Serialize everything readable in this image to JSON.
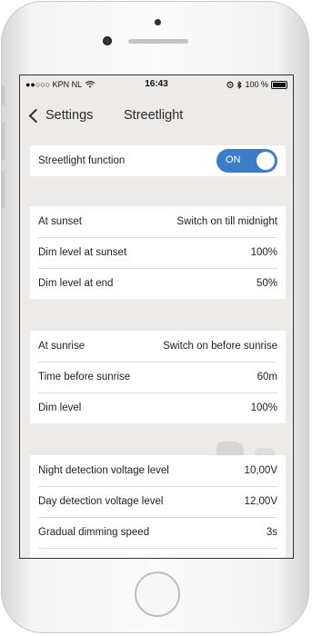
{
  "statusbar": {
    "carrier": "●●○○○ KPN NL",
    "time": "16:43",
    "battery": "100 %"
  },
  "nav": {
    "back_label": "Settings",
    "title": "Streetlight"
  },
  "function_row": {
    "label": "Streetlight function",
    "toggle_label": "ON",
    "toggle_on": true
  },
  "sunset_group": [
    {
      "label": "At sunset",
      "value": "Switch on till midnight"
    },
    {
      "label": "Dim level at sunset",
      "value": "100%"
    },
    {
      "label": "Dim level at end",
      "value": "50%"
    }
  ],
  "sunrise_group": [
    {
      "label": "At sunrise",
      "value": "Switch on before sunrise"
    },
    {
      "label": "Time before sunrise",
      "value": "60m"
    },
    {
      "label": "Dim level",
      "value": "100%"
    }
  ],
  "detection_group": [
    {
      "label": "Night detection voltage level",
      "value": "10,00V"
    },
    {
      "label": "Day detection voltage level",
      "value": "12,00V"
    },
    {
      "label": "Gradual dimming speed",
      "value": "3s"
    }
  ],
  "colors": {
    "accent": "#3d7cc9",
    "screen_bg": "#ecebea"
  }
}
